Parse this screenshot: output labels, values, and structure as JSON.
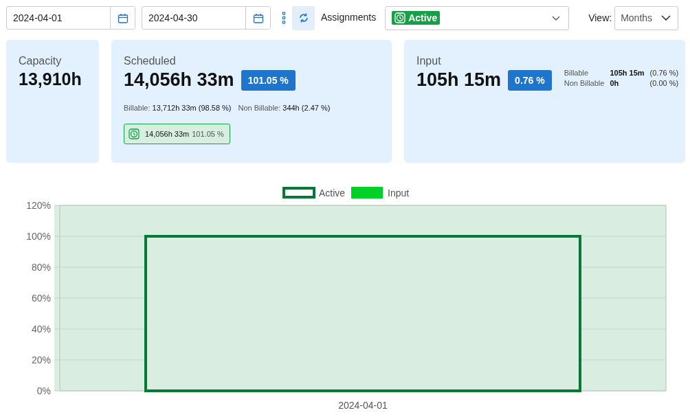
{
  "toolbar": {
    "start_date": "2024-04-01",
    "end_date": "2024-04-30",
    "assignments_label": "Assignments",
    "assignments_tag": "Active",
    "view_label": "View:",
    "view_value": "Months"
  },
  "cards": [
    {
      "kind": "simple",
      "title": "Capacity",
      "value": "13,910h"
    },
    {
      "kind": "scheduled",
      "title": "Scheduled",
      "value": "14,056h 33m",
      "badge": "101.05 %",
      "breakdown": [
        {
          "label": "Billable:",
          "value": "13,712h 33m (98.58 %)"
        },
        {
          "label": "Non Billable:",
          "value": "344h (2.47 %)"
        }
      ],
      "tag": {
        "value": "14,056h 33m",
        "percent": "101.05 %"
      }
    },
    {
      "kind": "input",
      "title": "Input",
      "value": "105h 15m",
      "badge": "0.76 %",
      "breakdown": [
        {
          "label": "Billable",
          "value": "105h 15m",
          "percent": "(0.76 %)"
        },
        {
          "label": "Non Billable",
          "value": "0h",
          "percent": "(0.00 %)"
        }
      ]
    }
  ],
  "chart": {
    "chart_data": {
      "type": "bar",
      "categories": [
        "2024-04-01"
      ],
      "series": [
        {
          "name": "Active",
          "color": "#047a35",
          "values": [
            100
          ]
        },
        {
          "name": "Input",
          "color": "#00d126",
          "values": [
            null
          ]
        }
      ],
      "grid": true,
      "ylim": [
        0,
        120
      ],
      "yticks": [
        {
          "value": 0,
          "label": "0%"
        },
        {
          "value": 20,
          "label": "20%"
        },
        {
          "value": 40,
          "label": "40%"
        },
        {
          "value": 60,
          "label": "60%"
        },
        {
          "value": 80,
          "label": "80%"
        },
        {
          "value": 100,
          "label": "100%"
        },
        {
          "value": 120,
          "label": "120%"
        }
      ]
    }
  }
}
